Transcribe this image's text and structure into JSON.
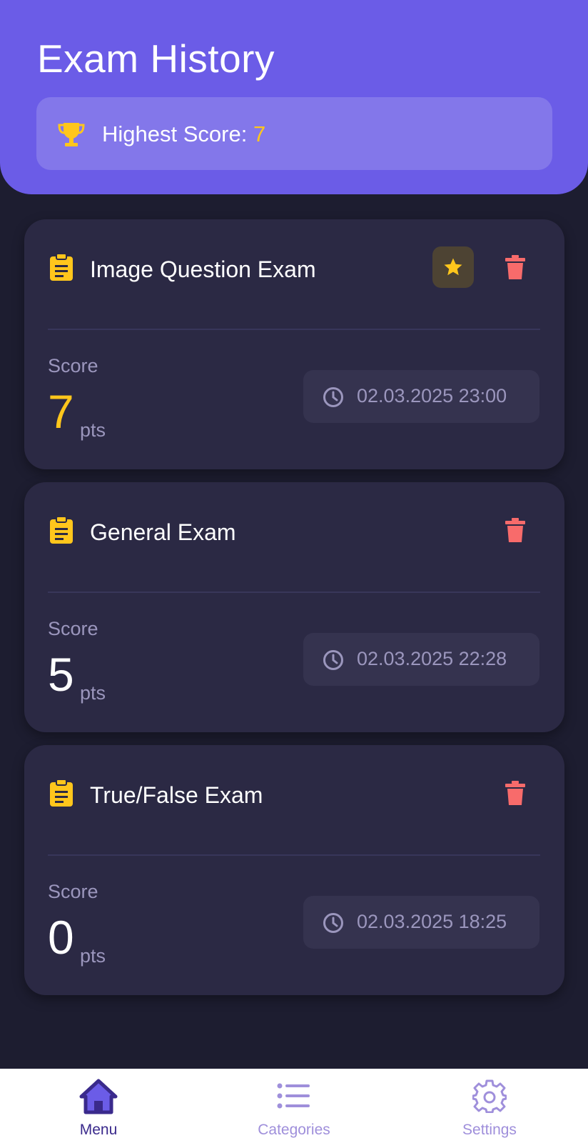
{
  "header": {
    "title": "Exam History",
    "highest_label": "Highest Score: ",
    "highest_value": "7"
  },
  "colors": {
    "header_bg": "#6b5ce7",
    "background": "#1d1d30",
    "card_bg": "#2b2944",
    "accent_yellow": "#ffc61c",
    "delete_red": "#f86b6b"
  },
  "icons": {
    "header": "trophy-icon",
    "card": "clipboard-icon",
    "favorite": "star-icon",
    "delete": "trash-icon",
    "date": "clock-icon"
  },
  "exams": [
    {
      "title": "Image Question Exam",
      "score_label": "Score",
      "score": "7",
      "unit": "pts",
      "date": "02.03.2025 23:00",
      "highest": true
    },
    {
      "title": "General Exam",
      "score_label": "Score",
      "score": "5",
      "unit": "pts",
      "date": "02.03.2025 22:28",
      "highest": false
    },
    {
      "title": "True/False Exam",
      "score_label": "Score",
      "score": "0",
      "unit": "pts",
      "date": "02.03.2025 18:25",
      "highest": false
    }
  ],
  "nav": {
    "items": [
      {
        "label": "Menu",
        "icon": "home-icon",
        "active": true
      },
      {
        "label": "Categories",
        "icon": "list-icon",
        "active": false
      },
      {
        "label": "Settings",
        "icon": "gear-icon",
        "active": false
      }
    ]
  }
}
